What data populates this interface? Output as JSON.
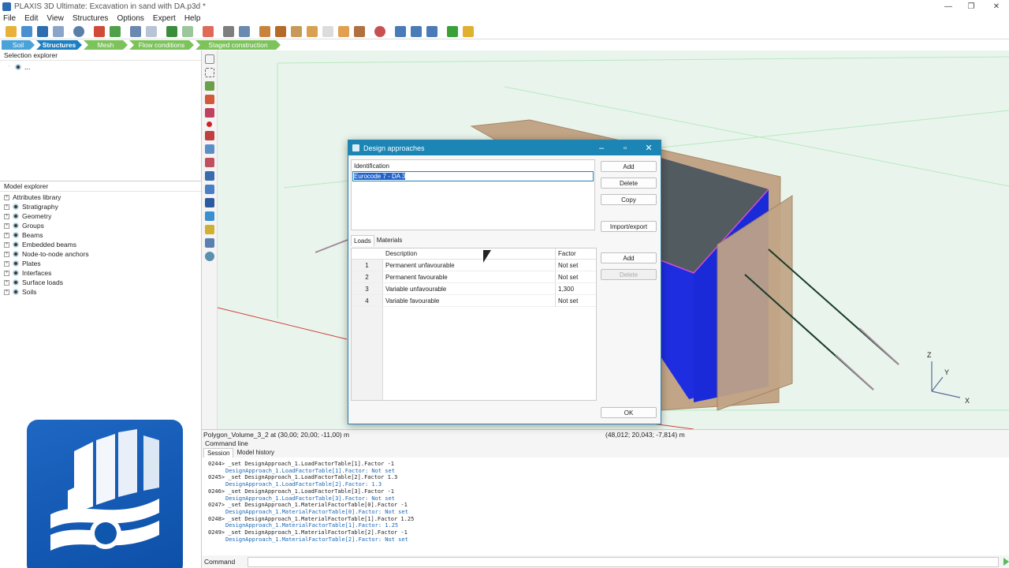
{
  "window": {
    "title": "PLAXIS 3D Ultimate: Excavation in sand with DA.p3d *"
  },
  "menu": [
    "File",
    "Edit",
    "View",
    "Structures",
    "Options",
    "Expert",
    "Help"
  ],
  "phases": {
    "soil": "Soil",
    "structures": "Structures",
    "mesh": "Mesh",
    "flow": "Flow conditions",
    "staged": "Staged construction"
  },
  "selection_explorer": {
    "title": "Selection explorer",
    "root": "..."
  },
  "model_explorer": {
    "title": "Model explorer",
    "items": [
      "Attributes library",
      "Stratigraphy",
      "Geometry",
      "Groups",
      "Beams",
      "Embedded beams",
      "Node-to-node anchors",
      "Plates",
      "Interfaces",
      "Surface loads",
      "Soils"
    ]
  },
  "status": {
    "object": "Polygon_Volume_3_2 at (30,00; 20,00; -11,00) m",
    "coords": "(48,012; 20,043; -7,814) m"
  },
  "command_line": {
    "title": "Command line",
    "tabs": [
      "Session",
      "Model history"
    ],
    "log": [
      {
        "cmd": "0244> _set DesignApproach_1.LoadFactorTable[1].Factor -1",
        "resp": "DesignApproach_1.LoadFactorTable[1].Factor: Not set"
      },
      {
        "cmd": "0245> _set DesignApproach_1.LoadFactorTable[2].Factor 1.3",
        "resp": "DesignApproach_1.LoadFactorTable[2].Factor: 1.3"
      },
      {
        "cmd": "0246> _set DesignApproach_1.LoadFactorTable[3].Factor -1",
        "resp": "DesignApproach_1.LoadFactorTable[3].Factor: Not set"
      },
      {
        "cmd": "0247> _set DesignApproach_1.MaterialFactorTable[0].Factor -1",
        "resp": "DesignApproach_1.MaterialFactorTable[0].Factor: Not set"
      },
      {
        "cmd": "0248> _set DesignApproach_1.MaterialFactorTable[1].Factor 1.25",
        "resp": "DesignApproach_1.MaterialFactorTable[1].Factor: 1.25"
      },
      {
        "cmd": "0249> _set DesignApproach_1.MaterialFactorTable[2].Factor -1",
        "resp": "DesignApproach_1.MaterialFactorTable[2].Factor: Not set"
      }
    ],
    "input_label": "Command"
  },
  "dialog": {
    "title": "Design approaches",
    "identification_label": "Identification",
    "identification_value": "Eurocode 7 - DA 3",
    "buttons": {
      "add": "Add",
      "delete": "Delete",
      "copy": "Copy",
      "import_export": "Import/export",
      "add2": "Add",
      "delete2": "Delete",
      "ok": "OK"
    },
    "tabs": [
      "Loads",
      "Materials"
    ],
    "table": {
      "headers": {
        "description": "Description",
        "factor": "Factor"
      },
      "rows": [
        {
          "num": "1",
          "desc": "Permanent unfavourable",
          "factor": "Not set"
        },
        {
          "num": "2",
          "desc": "Permanent favourable",
          "factor": "Not set"
        },
        {
          "num": "3",
          "desc": "Variable unfavourable",
          "factor": "1,300"
        },
        {
          "num": "4",
          "desc": "Variable favourable",
          "factor": "Not set"
        }
      ]
    }
  },
  "axes": {
    "z": "Z",
    "y": "Y",
    "x": "X"
  }
}
